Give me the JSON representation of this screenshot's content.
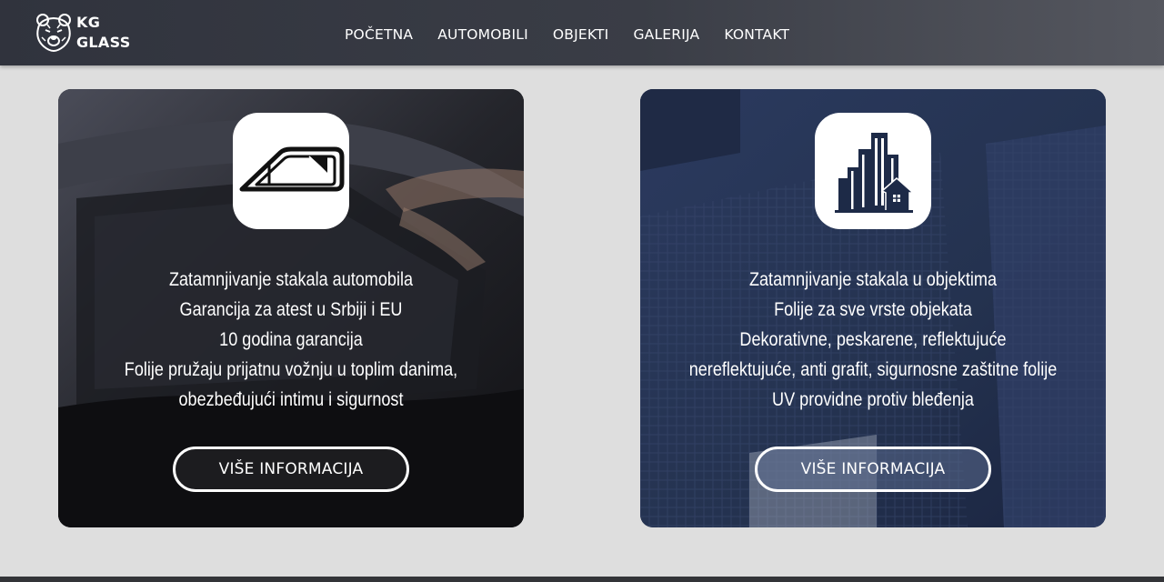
{
  "brand": {
    "logo_icon": "bear-head-icon",
    "line1": "KG",
    "line2": "GLASS"
  },
  "nav": {
    "items": [
      {
        "label": "POČETNA"
      },
      {
        "label": "AUTOMOBILI"
      },
      {
        "label": "OBJEKTI"
      },
      {
        "label": "GALERIJA"
      },
      {
        "label": "KONTAKT"
      }
    ]
  },
  "cards": [
    {
      "icon": "car-window-icon",
      "lines": [
        "Zatamnjivanje stakala automobila",
        "Garancija za atest u Srbiji i EU",
        "10 godina garancija",
        "Folije pružaju prijatnu vožnju u toplim danima,",
        "obezbeđujući intimu i sigurnost"
      ],
      "button_label": "VIŠE INFORMACIJA"
    },
    {
      "icon": "city-buildings-icon",
      "lines": [
        "Zatamnjivanje stakala u objektima",
        "Folije za sve vrste objekata",
        "Dekorativne, peskarene, reflektujuće",
        "nereflektujuće, anti grafit, sigurnosne zaštitne folije",
        "UV providne protiv bleđenja"
      ],
      "button_label": "VIŠE INFORMACIJA"
    }
  ],
  "colors": {
    "page_bg": "#dedede",
    "navbar": "#30333d",
    "card_left_bg": "#17181c",
    "card_right_bg": "#22304f"
  }
}
